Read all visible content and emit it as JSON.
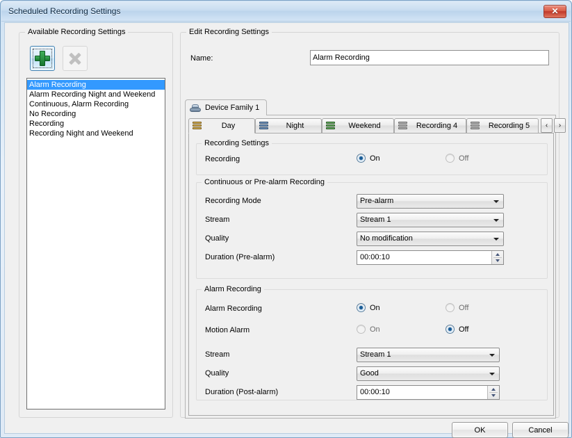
{
  "window": {
    "title": "Scheduled Recording Settings",
    "close_icon": "close-icon",
    "close_label": "✕"
  },
  "available_panel": {
    "title": "Available Recording Settings",
    "add_button_icon": "plus-icon",
    "delete_button_icon": "delete-x-icon",
    "items": [
      {
        "label": "Alarm Recording",
        "selected": true
      },
      {
        "label": "Alarm Recording Night and Weekend",
        "selected": false
      },
      {
        "label": "Continuous, Alarm Recording",
        "selected": false
      },
      {
        "label": "No Recording",
        "selected": false
      },
      {
        "label": "Recording",
        "selected": false
      },
      {
        "label": "Recording Night and Weekend",
        "selected": false
      }
    ]
  },
  "edit_panel": {
    "title": "Edit Recording Settings",
    "name_label": "Name:",
    "name_value": "Alarm Recording",
    "device_tabs": [
      {
        "label": "Device Family 1",
        "icon": "device-icon",
        "active": true
      }
    ],
    "schedule_tabs": [
      {
        "label": "Day",
        "icon": "schedule-icon-gold",
        "active": true
      },
      {
        "label": "Night",
        "icon": "schedule-icon-blue",
        "active": false
      },
      {
        "label": "Weekend",
        "icon": "schedule-icon-green",
        "active": false
      },
      {
        "label": "Recording 4",
        "icon": "schedule-icon-grey",
        "active": false
      },
      {
        "label": "Recording 5",
        "icon": "schedule-icon-grey",
        "active": false
      }
    ],
    "tab_nav": {
      "prev": "‹",
      "next": "›"
    },
    "recording_settings": {
      "group_title": "Recording Settings",
      "recording_label": "Recording",
      "on_label": "On",
      "off_label": "Off",
      "value": "On"
    },
    "continuous": {
      "group_title": "Continuous or Pre-alarm Recording",
      "recording_mode_label": "Recording Mode",
      "recording_mode_value": "Pre-alarm",
      "stream_label": "Stream",
      "stream_value": "Stream 1",
      "quality_label": "Quality",
      "quality_value": "No modification",
      "duration_label": "Duration (Pre-alarm)",
      "duration_value": "00:00:10"
    },
    "alarm": {
      "group_title": "Alarm Recording",
      "alarm_recording_label": "Alarm Recording",
      "alarm_recording_on": "On",
      "alarm_recording_off": "Off",
      "alarm_recording_value": "On",
      "motion_alarm_label": "Motion Alarm",
      "motion_alarm_on": "On",
      "motion_alarm_off": "Off",
      "motion_alarm_value": "Off",
      "stream_label": "Stream",
      "stream_value": "Stream 1",
      "quality_label": "Quality",
      "quality_value": "Good",
      "duration_label": "Duration (Post-alarm)",
      "duration_value": "00:00:10"
    }
  },
  "footer": {
    "ok_label": "OK",
    "cancel_label": "Cancel"
  },
  "colors": {
    "selection": "#3399ff",
    "title_bar": "#c8dcf0",
    "close_button": "#c0392a",
    "radio_dot": "#1a5c96",
    "add_icon_green": "#17772f"
  }
}
